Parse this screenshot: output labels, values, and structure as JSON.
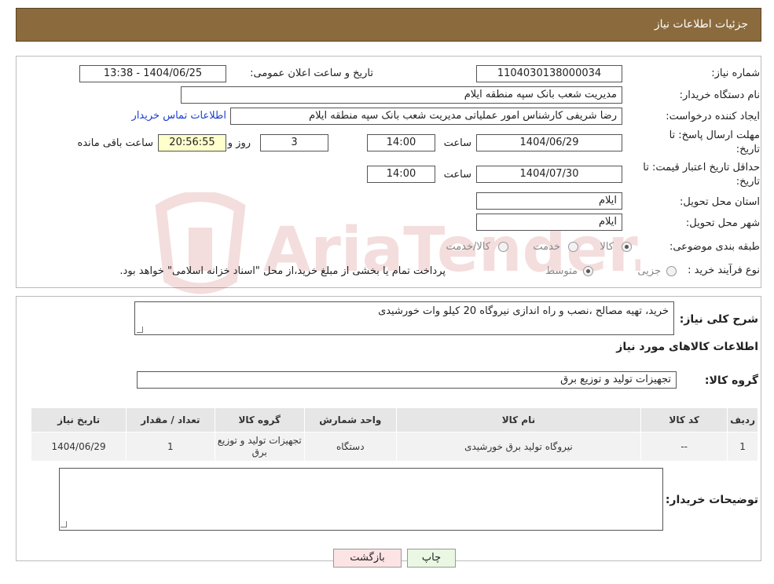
{
  "header": {
    "title": "جزئیات اطلاعات نیاز"
  },
  "fields": {
    "need_number_label": "شماره نیاز:",
    "need_number": "1104030138000034",
    "announce_label": "تاریخ و ساعت اعلان عمومی:",
    "announce_value": "1404/06/25 - 13:38",
    "buyer_org_label": "نام دستگاه خریدار:",
    "buyer_org": "مدیریت شعب بانک سپه منطقه ایلام",
    "creator_label": "ایجاد کننده درخواست:",
    "creator": "رضا شریفی کارشناس امور عملیاتی مدیریت شعب بانک سپه منطقه ایلام",
    "contact_link": "اطلاعات تماس خریدار",
    "deadline_label_line1": "مهلت ارسال پاسخ: تا",
    "deadline_label_line2": "تاریخ:",
    "deadline_date": "1404/06/29",
    "time_label": "ساعت",
    "deadline_time": "14:00",
    "days_value": "3",
    "days_label": "روز و",
    "remaining_time": "20:56:55",
    "remaining_label": "ساعت باقی مانده",
    "validity_label_line1": "حداقل تاریخ اعتبار قیمت: تا",
    "validity_label_line2": "تاریخ:",
    "validity_date": "1404/07/30",
    "validity_time": "14:00",
    "province_label": "استان محل تحویل:",
    "province": "ایلام",
    "city_label": "شهر محل تحویل:",
    "city": "ایلام",
    "category_label": "طبقه بندی موضوعی:",
    "category_options": [
      "کالا",
      "خدمت",
      "کالا/خدمت"
    ],
    "process_label": "نوع فرآیند خرید :",
    "process_options": [
      "جزیی",
      "متوسط"
    ],
    "process_note": "پرداخت تمام یا بخشی از مبلغ خرید،از محل \"اسناد خزانه اسلامی\" خواهد بود."
  },
  "description": {
    "label": "شرح کلی نیاز:",
    "text": "خرید، تهیه مصالح ،نصب و راه اندازی نیروگاه 20 کیلو وات خورشیدی"
  },
  "goods_info_title": "اطلاعات کالاهای مورد نیاز",
  "goods_group": {
    "label": "گروه کالا:",
    "value": "تجهیزات تولید و توزیع برق"
  },
  "table": {
    "headers": [
      "ردیف",
      "کد کالا",
      "نام کالا",
      "واحد شمارش",
      "گروه کالا",
      "تعداد / مقدار",
      "تاریخ نیاز"
    ],
    "rows": [
      {
        "row": "1",
        "code": "--",
        "name": "نیروگاه تولید برق خورشیدی",
        "unit": "دستگاه",
        "group": "تجهیزات تولید و توزیع برق",
        "qty": "1",
        "date": "1404/06/29"
      }
    ]
  },
  "buyer_notes": {
    "label": "توضیحات خریدار:",
    "text": ""
  },
  "buttons": {
    "print": "چاپ",
    "back": "بازگشت"
  },
  "watermark": {
    "text": "AriaTender.neT"
  },
  "colors": {
    "header_bg": "#8b6a3d",
    "highlight": "#ffffcc",
    "link": "#1a3fd1"
  }
}
